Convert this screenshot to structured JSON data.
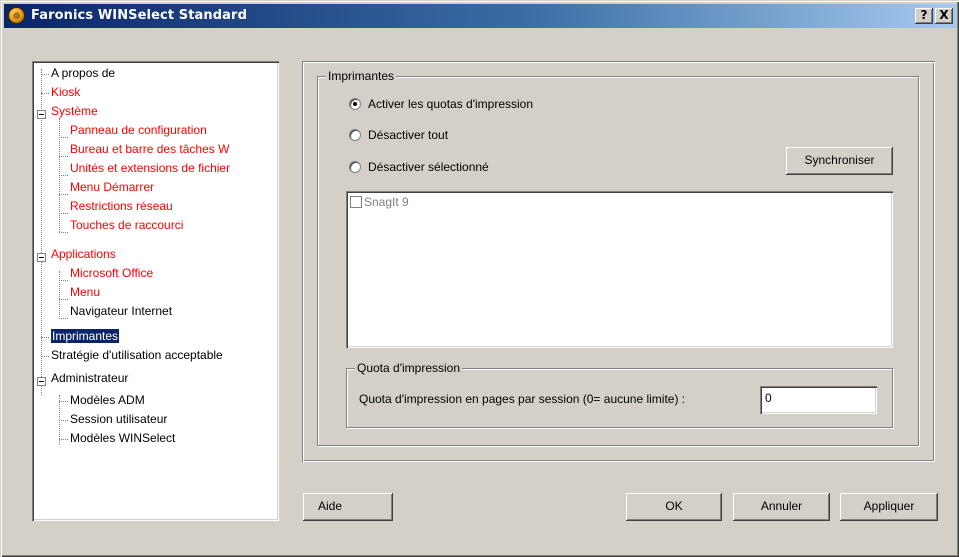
{
  "window": {
    "title": "Faronics WINSelect Standard",
    "help_button": "?",
    "close_button": "X"
  },
  "tree": {
    "items": [
      {
        "label": "A propos de",
        "red": false
      },
      {
        "label": "Kiosk",
        "red": true
      },
      {
        "label": "Système",
        "red": true,
        "expanded": true
      },
      {
        "label": "Panneau de configuration",
        "red": true
      },
      {
        "label": "Bureau et barre des tâches W",
        "red": true
      },
      {
        "label": "Unités et extensions de fichier",
        "red": true
      },
      {
        "label": "Menu Démarrer",
        "red": true
      },
      {
        "label": "Restrictions réseau",
        "red": true
      },
      {
        "label": "Touches de raccourci",
        "red": true
      },
      {
        "label": "Applications",
        "red": true,
        "expanded": true
      },
      {
        "label": "Microsoft Office",
        "red": true
      },
      {
        "label": "Menu",
        "red": true
      },
      {
        "label": "Navigateur Internet",
        "red": false
      },
      {
        "label": "Imprimantes",
        "red": false,
        "selected": true
      },
      {
        "label": "Stratégie d'utilisation acceptable",
        "red": false
      },
      {
        "label": "Administrateur",
        "red": false,
        "expanded": true
      },
      {
        "label": "Modèles ADM",
        "red": false
      },
      {
        "label": "Session utilisateur",
        "red": false
      },
      {
        "label": "Modèles WINSelect",
        "red": false
      }
    ]
  },
  "printers": {
    "group_label": "Imprimantes",
    "radio_enable_quotas": "Activer les quotas d'impression",
    "radio_disable_all": "Désactiver tout",
    "radio_disable_selected": "Désactiver sélectionné",
    "selected_radio": "enable_quotas",
    "sync_button": "Synchroniser",
    "printer_list": [
      {
        "name": "SnagIt 9",
        "checked": false
      }
    ],
    "quota": {
      "group_label": "Quota d'impression",
      "label": "Quota d'impression en pages par session (0= aucune limite) :",
      "value": "0"
    }
  },
  "footer": {
    "help": "Aide",
    "ok": "OK",
    "cancel": "Annuler",
    "apply": "Appliquer"
  }
}
